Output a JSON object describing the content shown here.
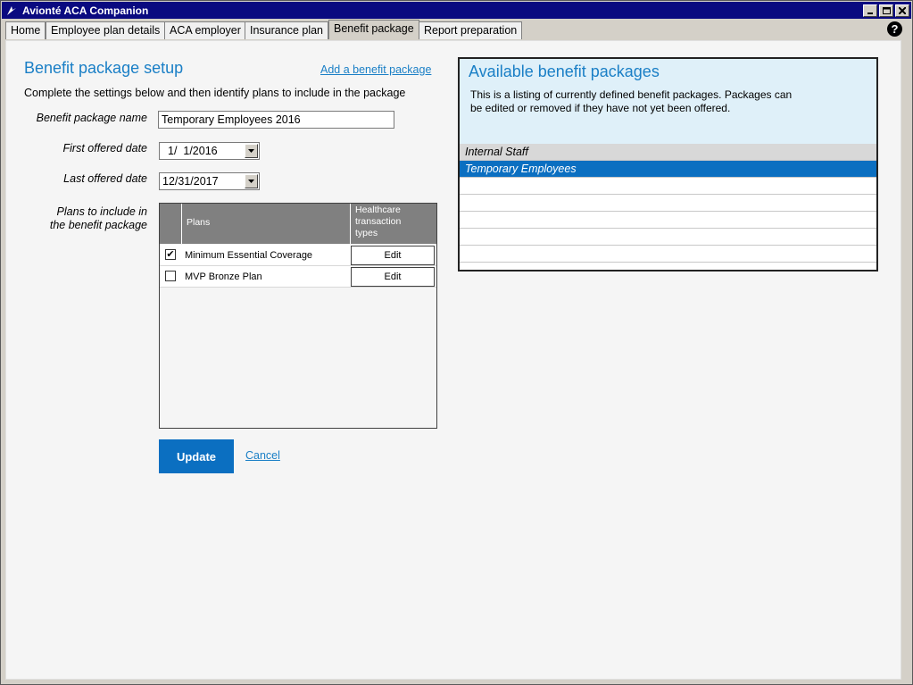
{
  "window": {
    "title": "Avionté ACA Companion"
  },
  "tabs": [
    {
      "label": "Home"
    },
    {
      "label": "Employee plan details"
    },
    {
      "label": "ACA employer"
    },
    {
      "label": "Insurance plan"
    },
    {
      "label": "Benefit package"
    },
    {
      "label": "Report preparation"
    }
  ],
  "active_tab": "Benefit package",
  "help_icon": "question-circle-icon",
  "setup": {
    "title": "Benefit package setup",
    "add_link": "Add a benefit package",
    "instructions": "Complete the settings below and then identify plans to include in the package",
    "name_label": "Benefit package name",
    "name_value": "Temporary Employees 2016",
    "first_label": "First offered date",
    "first_value": "1/  1/2016",
    "last_label": "Last offered date",
    "last_value": "12/31/2017",
    "plans_label_1": "Plans to include in",
    "plans_label_2": "the benefit package",
    "plans_header": "Plans",
    "healthcare_header_1": "Healthcare",
    "healthcare_header_2": "transaction",
    "healthcare_header_3": "types",
    "plans": [
      {
        "name": "Minimum Essential Coverage",
        "checked": "✔",
        "edit": "Edit"
      },
      {
        "name": "MVP Bronze Plan",
        "checked": "",
        "edit": "Edit"
      }
    ],
    "update_label": "Update",
    "cancel_label": "Cancel"
  },
  "available": {
    "title": "Available benefit packages",
    "desc_1": "This is a listing of currently defined benefit packages. Packages can",
    "desc_2": "be edited or removed if they have not yet been offered.",
    "packages": [
      {
        "name": "Internal Staff"
      },
      {
        "name": "Temporary Employees"
      },
      {
        "name": ""
      },
      {
        "name": ""
      },
      {
        "name": ""
      },
      {
        "name": ""
      },
      {
        "name": ""
      }
    ]
  },
  "colors": {
    "accent": "#1a7fc6",
    "selected_row": "#0b6fc1",
    "header_row": "#d8d8d8",
    "title_bar": "#0a0a80"
  }
}
